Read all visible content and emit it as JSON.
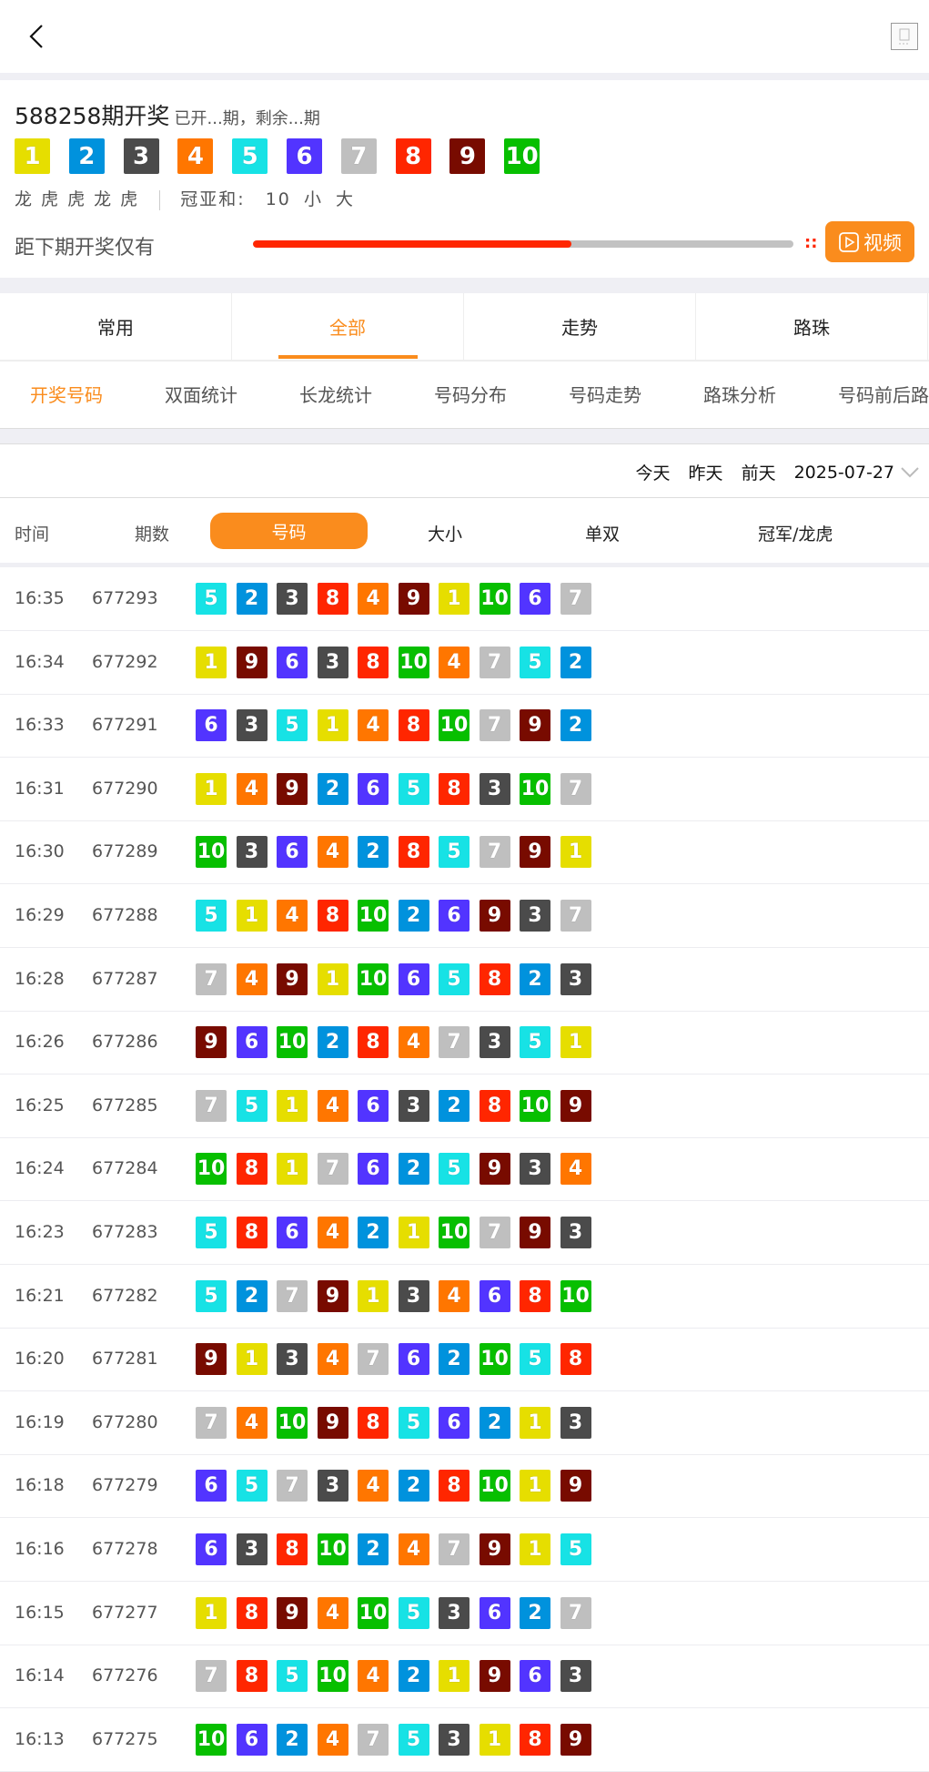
{
  "header": {
    "back_icon": "chevron-left-icon",
    "right_icon": "image-placeholder-icon"
  },
  "draw": {
    "title": "588258期开奖",
    "subtitle": "已开...期，剩余...期",
    "numbers": [
      1,
      2,
      3,
      4,
      5,
      6,
      7,
      8,
      9,
      10
    ],
    "dragon_tiger": "龙 虎 虎 龙 虎",
    "sum_label": "冠亚和:",
    "sum_value": "10",
    "sum_size": "小",
    "sum_big": "大",
    "countdown_label": "距下期开奖仅有",
    "countdown_progress": 0.59,
    "countdown_sep": "::",
    "video_label": "视频"
  },
  "tabs": [
    {
      "label": "常用"
    },
    {
      "label": "全部",
      "active": true
    },
    {
      "label": "走势"
    },
    {
      "label": "路珠"
    }
  ],
  "subtabs": [
    {
      "label": "开奖号码",
      "active": true
    },
    {
      "label": "双面统计"
    },
    {
      "label": "长龙统计"
    },
    {
      "label": "号码分布"
    },
    {
      "label": "号码走势"
    },
    {
      "label": "路珠分析"
    },
    {
      "label": "号码前后路"
    }
  ],
  "dates": {
    "today": "今天",
    "yesterday": "昨天",
    "day_before": "前天",
    "selected": "2025-07-27"
  },
  "columns": {
    "time": "时间",
    "issue": "期数",
    "numbers": "号码",
    "size": "大小",
    "odd_even": "单双",
    "champion": "冠军/龙虎"
  },
  "colors": {
    "accent": "#fa8c1d",
    "1": "#e6de00",
    "2": "#0092dd",
    "3": "#4b4b4b",
    "4": "#ff7600",
    "5": "#17e2e5",
    "6": "#5234ff",
    "7": "#bfbfbf",
    "8": "#ff2600",
    "9": "#780b00",
    "10": "#07bf00"
  },
  "rows": [
    {
      "time": "16:35",
      "issue": "677293",
      "nums": [
        5,
        2,
        3,
        8,
        4,
        9,
        1,
        10,
        6,
        7
      ]
    },
    {
      "time": "16:34",
      "issue": "677292",
      "nums": [
        1,
        9,
        6,
        3,
        8,
        10,
        4,
        7,
        5,
        2
      ]
    },
    {
      "time": "16:33",
      "issue": "677291",
      "nums": [
        6,
        3,
        5,
        1,
        4,
        8,
        10,
        7,
        9,
        2
      ]
    },
    {
      "time": "16:31",
      "issue": "677290",
      "nums": [
        1,
        4,
        9,
        2,
        6,
        5,
        8,
        3,
        10,
        7
      ]
    },
    {
      "time": "16:30",
      "issue": "677289",
      "nums": [
        10,
        3,
        6,
        4,
        2,
        8,
        5,
        7,
        9,
        1
      ]
    },
    {
      "time": "16:29",
      "issue": "677288",
      "nums": [
        5,
        1,
        4,
        8,
        10,
        2,
        6,
        9,
        3,
        7
      ]
    },
    {
      "time": "16:28",
      "issue": "677287",
      "nums": [
        7,
        4,
        9,
        1,
        10,
        6,
        5,
        8,
        2,
        3
      ]
    },
    {
      "time": "16:26",
      "issue": "677286",
      "nums": [
        9,
        6,
        10,
        2,
        8,
        4,
        7,
        3,
        5,
        1
      ]
    },
    {
      "time": "16:25",
      "issue": "677285",
      "nums": [
        7,
        5,
        1,
        4,
        6,
        3,
        2,
        8,
        10,
        9
      ]
    },
    {
      "time": "16:24",
      "issue": "677284",
      "nums": [
        10,
        8,
        1,
        7,
        6,
        2,
        5,
        9,
        3,
        4
      ]
    },
    {
      "time": "16:23",
      "issue": "677283",
      "nums": [
        5,
        8,
        6,
        4,
        2,
        1,
        10,
        7,
        9,
        3
      ]
    },
    {
      "time": "16:21",
      "issue": "677282",
      "nums": [
        5,
        2,
        7,
        9,
        1,
        3,
        4,
        6,
        8,
        10
      ]
    },
    {
      "time": "16:20",
      "issue": "677281",
      "nums": [
        9,
        1,
        3,
        4,
        7,
        6,
        2,
        10,
        5,
        8
      ]
    },
    {
      "time": "16:19",
      "issue": "677280",
      "nums": [
        7,
        4,
        10,
        9,
        8,
        5,
        6,
        2,
        1,
        3
      ]
    },
    {
      "time": "16:18",
      "issue": "677279",
      "nums": [
        6,
        5,
        7,
        3,
        4,
        2,
        8,
        10,
        1,
        9
      ]
    },
    {
      "time": "16:16",
      "issue": "677278",
      "nums": [
        6,
        3,
        8,
        10,
        2,
        4,
        7,
        9,
        1,
        5
      ]
    },
    {
      "time": "16:15",
      "issue": "677277",
      "nums": [
        1,
        8,
        9,
        4,
        10,
        5,
        3,
        6,
        2,
        7
      ]
    },
    {
      "time": "16:14",
      "issue": "677276",
      "nums": [
        7,
        8,
        5,
        10,
        4,
        2,
        1,
        9,
        6,
        3
      ]
    },
    {
      "time": "16:13",
      "issue": "677275",
      "nums": [
        10,
        6,
        2,
        4,
        7,
        5,
        3,
        1,
        8,
        9
      ]
    }
  ]
}
